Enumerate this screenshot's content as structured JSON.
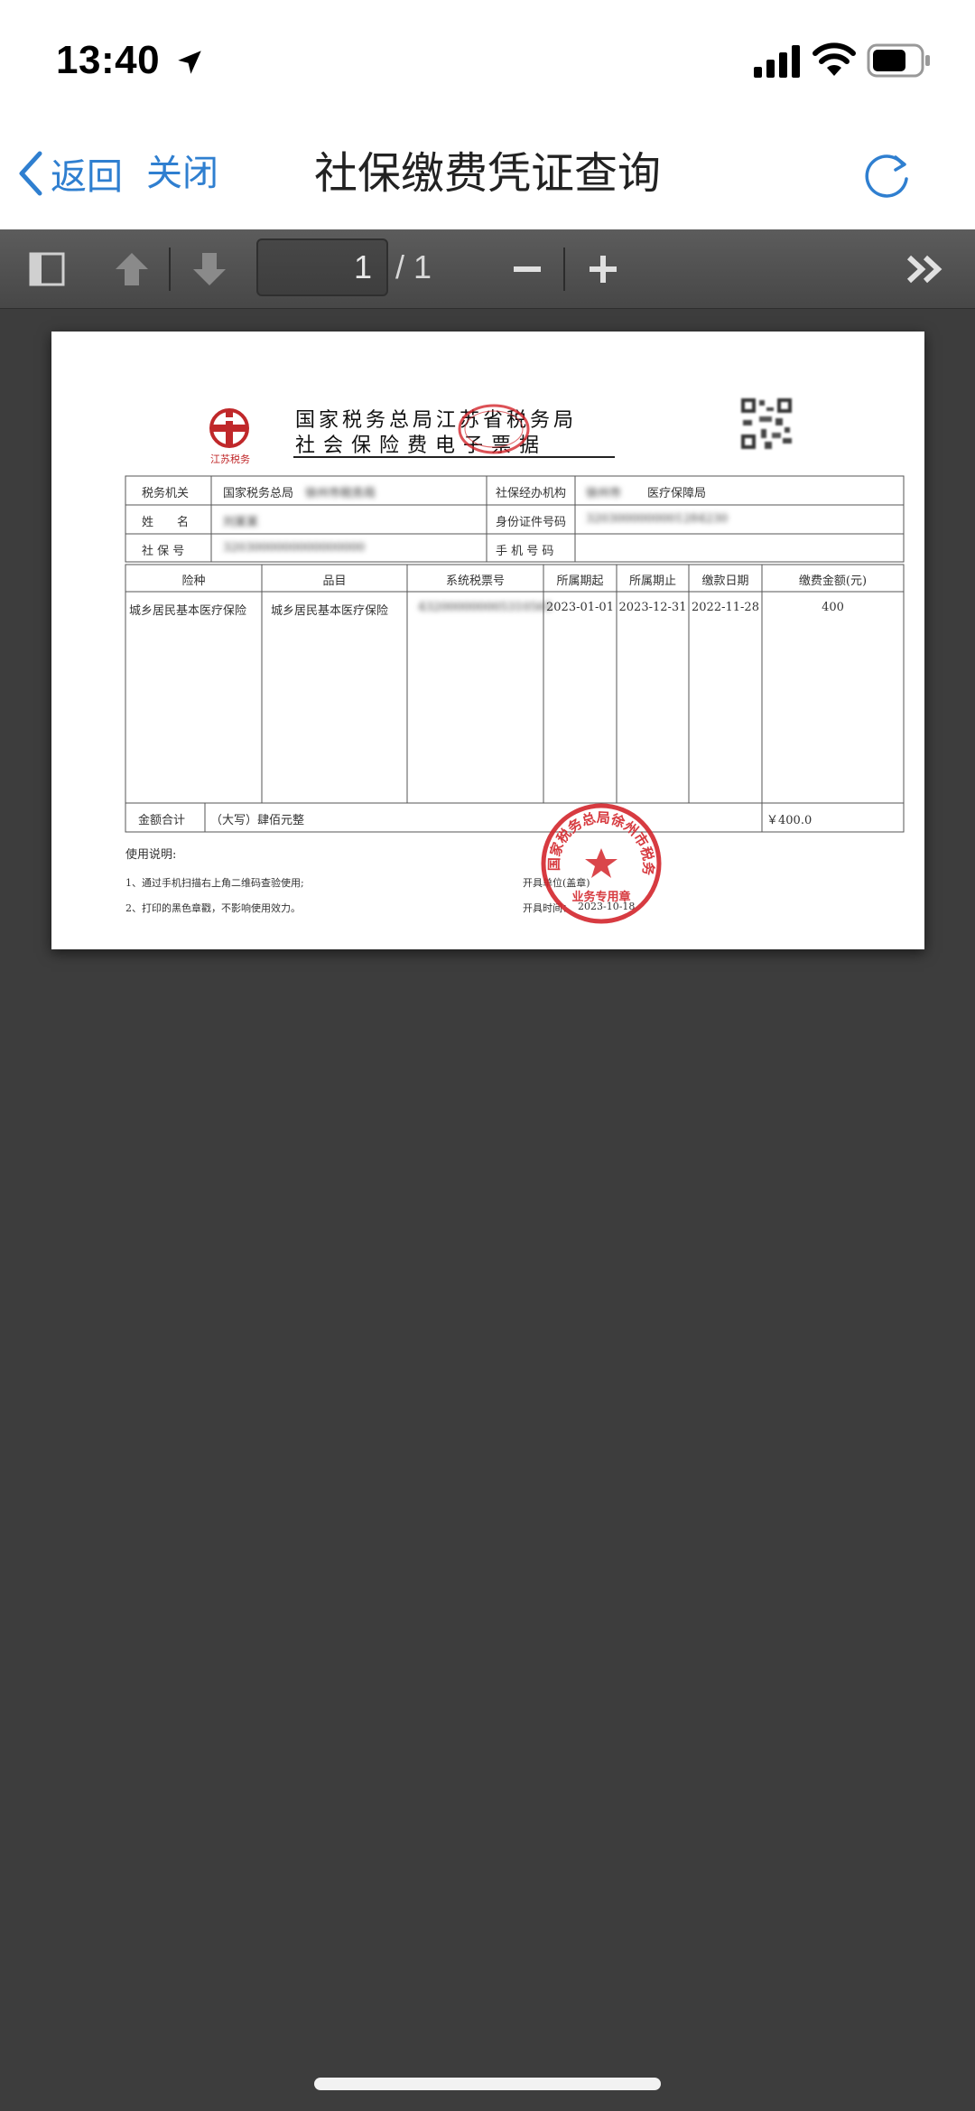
{
  "status_bar": {
    "time": "13:40"
  },
  "nav": {
    "back_label": "返回",
    "close_label": "关闭",
    "title": "社保缴费凭证查询"
  },
  "pdf_toolbar": {
    "current_page": "1",
    "page_total": "/ 1"
  },
  "document": {
    "logo_text": "江苏税务",
    "title_line1": "国家税务总局江苏省税务局",
    "title_line2": "社会保险费电子票据",
    "header_rows": [
      {
        "label": "税务机关",
        "value": "国家税务总局",
        "value_redacted": "徐州市税务局",
        "label2": "社保经办机构",
        "value2_redacted": "徐州市",
        "value2": "医疗保障局"
      },
      {
        "label": "姓　　名",
        "value_redacted": "刘某某",
        "label2": "身份证件号码",
        "value2_redacted": "3203000000001284230"
      },
      {
        "label": "社 保 号",
        "value_redacted": "3203000000000000000",
        "label2": "手 机 号 码",
        "value2": ""
      }
    ],
    "columns": [
      "险种",
      "品目",
      "系统税票号",
      "所属期起",
      "所属期止",
      "缴款日期",
      "缴费金额(元)"
    ],
    "rows": [
      [
        "城乡居民基本医疗保险",
        "城乡居民基本医疗保险",
        "432000000005310565",
        "2023-01-01",
        "2023-12-31",
        "2022-11-28",
        "400"
      ]
    ],
    "total_label": "金额合计",
    "total_words": "（大写）肆佰元整",
    "total_amount": "￥400.0",
    "usage_title": "使用说明:",
    "usage_notes": [
      "1、通过手机扫描右上角二维码查验使用;",
      "2、打印的黑色章戳，不影响使用效力。"
    ],
    "issuer_label": "开具单位(盖章)",
    "issue_time_label": "开具时间：",
    "issue_date": "2023-10-18",
    "seal_text": "国家税务总局徐州市税务局",
    "seal_bottom": "业务专用章"
  },
  "colors": {
    "link_blue": "#2f7fd0",
    "seal_red": "#d3262c",
    "viewer_bg": "#3d3d3d"
  }
}
